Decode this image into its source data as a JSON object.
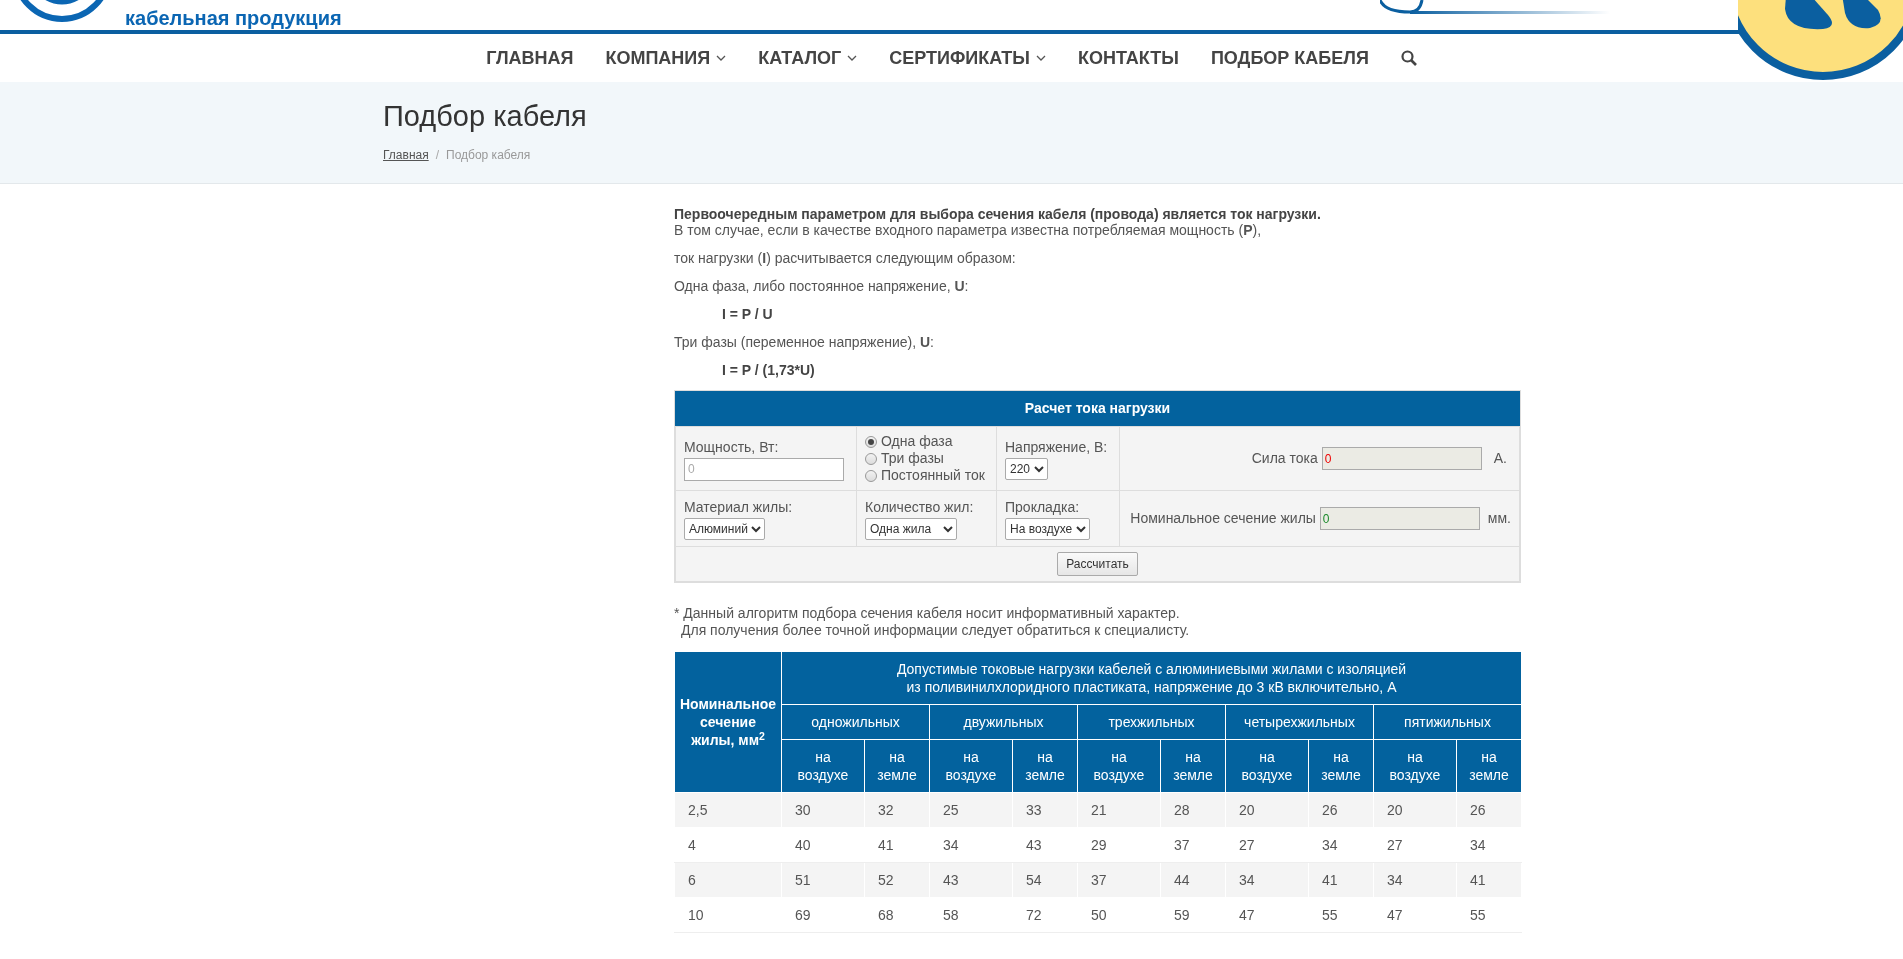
{
  "header": {
    "logo_text": "кабельная продукция"
  },
  "nav": {
    "items": [
      {
        "label": "ГЛАВНАЯ",
        "has_menu": false
      },
      {
        "label": "КОМПАНИЯ",
        "has_menu": true
      },
      {
        "label": "КАТАЛОГ",
        "has_menu": true
      },
      {
        "label": "СЕРТИФИКАТЫ",
        "has_menu": true
      },
      {
        "label": "КОНТАКТЫ",
        "has_menu": false
      },
      {
        "label": "ПОДБОР КАБЕЛЯ",
        "has_menu": false
      }
    ]
  },
  "page_title": "Подбор кабеля",
  "breadcrumb": {
    "separator": "/",
    "items": [
      {
        "label": "Главная",
        "current": false
      },
      {
        "label": "Подбор кабеля",
        "current": true
      }
    ]
  },
  "intro": [
    {
      "kind": "lead",
      "text": "Первоочередным параметром для выбора сечения кабеля (провода) является ток нагрузки."
    },
    {
      "kind": "line",
      "text": "В том случае, если в качестве входного параметра известна потребляемая мощность (**P**),"
    },
    {
      "kind": "text",
      "text": "ток нагрузки (**I**) расчитывается следующим образом:"
    },
    {
      "kind": "text",
      "text": "Одна фаза, либо постоянное напряжение, **U**:"
    },
    {
      "kind": "formula",
      "text": "I = P / U"
    },
    {
      "kind": "text",
      "text": "Три фазы (переменное напряжение), **U**:"
    },
    {
      "kind": "formula",
      "text": "I = P / (1,73*U)"
    }
  ],
  "calculator": {
    "title": "Расчет тока нагрузки",
    "power": {
      "label": "Мощность, Вт:",
      "placeholder": "0"
    },
    "phase_options": [
      {
        "label": "Одна фаза",
        "selected": true
      },
      {
        "label": "Три фазы",
        "selected": false
      },
      {
        "label": "Постоянный ток",
        "selected": false
      }
    ],
    "voltage": {
      "label": "Напряжение, В:",
      "value": "220"
    },
    "current": {
      "label": "Сила тока",
      "value": "0",
      "unit": "А."
    },
    "material": {
      "label": "Материал жилы:",
      "value": "Алюминий"
    },
    "cores": {
      "label": "Количество жил:",
      "value": "Одна жила"
    },
    "laying": {
      "label": "Прокладка:",
      "value": "На воздухе"
    },
    "section": {
      "label": "Номинальное сечение жилы",
      "value": "0",
      "unit": "мм."
    },
    "button": "Рассчитать"
  },
  "note": [
    "* Данный алгоритм подбора сечения кабеля носит информативный характер.",
    "Для получения более точной информации следует обратиться к специалисту."
  ],
  "table": {
    "row_header": "Номинальное сечение жилы, мм$^{2}$",
    "title_lines": [
      "Допустимые токовые нагрузки кабелей с алюминиевыми жилами с изоляцией",
      "из поливинилхлоридного пластиката, напряжение до 3 кВ включительно, А"
    ],
    "groups": [
      "одножильных",
      "двужильных",
      "трехжильных",
      "четырехжильных",
      "пятижильных"
    ],
    "subcolumns": [
      "на воздухе",
      "на земле",
      "на воздухе",
      "на земле",
      "на воздухе",
      "на земле",
      "на воздухе",
      "на земле",
      "на воздухе",
      "на земле"
    ],
    "rows": [
      [
        "2,5",
        "30",
        "32",
        "25",
        "33",
        "21",
        "28",
        "20",
        "26",
        "20",
        "26"
      ],
      [
        "4",
        "40",
        "41",
        "34",
        "43",
        "29",
        "37",
        "27",
        "34",
        "27",
        "34"
      ],
      [
        "6",
        "51",
        "52",
        "43",
        "54",
        "37",
        "44",
        "34",
        "41",
        "34",
        "41"
      ],
      [
        "10",
        "69",
        "68",
        "58",
        "72",
        "50",
        "59",
        "47",
        "55",
        "47",
        "55"
      ]
    ]
  }
}
